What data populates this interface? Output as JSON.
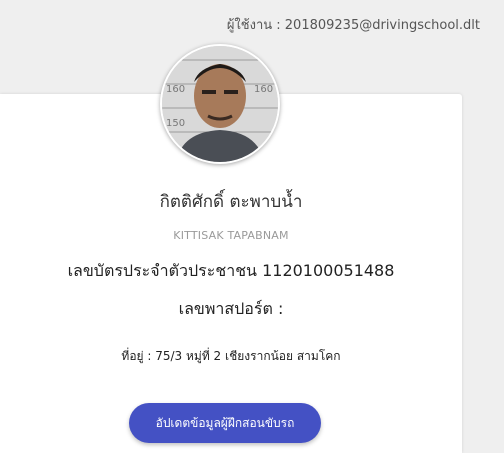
{
  "header": {
    "user_label": "ผู้ใช้งาน : 201809235@drivingschool.dlt"
  },
  "profile": {
    "name_th": "กิตติศักดิ์ ตะพาบน้ำ",
    "name_en": "KITTISAK TAPABNAM",
    "id_card": "เลขบัตรประจำตัวประชาชน 1120100051488",
    "passport": "เลขพาสปอร์ต :",
    "address": "ที่อยู่ : 75/3 หมู่ที่ 2 เชียงรากน้อย สามโคก",
    "photo_scale_marks": [
      "160",
      "150",
      "160"
    ]
  },
  "actions": {
    "update_label": "อัปเดตข้อมูลผู้ฝึกสอนขับรถ"
  }
}
